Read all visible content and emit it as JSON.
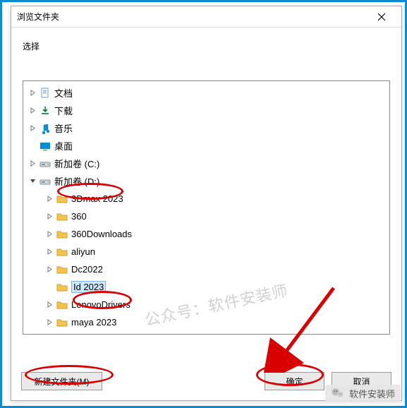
{
  "dialog": {
    "title": "浏览文件夹",
    "subtitle": "选择",
    "close_tooltip": "关闭"
  },
  "tree": {
    "items": [
      {
        "label": "文档",
        "icon": "document",
        "expandable": true,
        "depth": 1
      },
      {
        "label": "下载",
        "icon": "download",
        "expandable": true,
        "depth": 1
      },
      {
        "label": "音乐",
        "icon": "music",
        "expandable": true,
        "depth": 1
      },
      {
        "label": "桌面",
        "icon": "desktop",
        "expandable": false,
        "depth": 1
      },
      {
        "label": "新加卷 (C:)",
        "icon": "drive",
        "expandable": true,
        "depth": 1
      },
      {
        "label": "新加卷 (D:)",
        "icon": "drive",
        "expandable": true,
        "expanded": true,
        "depth": 1,
        "highlighted": true
      },
      {
        "label": "3Dmax 2023",
        "icon": "folder",
        "expandable": true,
        "depth": 2
      },
      {
        "label": "360",
        "icon": "folder",
        "expandable": true,
        "depth": 2
      },
      {
        "label": "360Downloads",
        "icon": "folder",
        "expandable": true,
        "depth": 2
      },
      {
        "label": "aliyun",
        "icon": "folder",
        "expandable": true,
        "depth": 2
      },
      {
        "label": "Dc2022",
        "icon": "folder",
        "expandable": true,
        "depth": 2
      },
      {
        "label": "Id 2023",
        "icon": "folder",
        "expandable": false,
        "depth": 2,
        "selected": true,
        "highlighted": true
      },
      {
        "label": "LenovoDrivers",
        "icon": "folder",
        "expandable": true,
        "depth": 2
      },
      {
        "label": "maya 2023",
        "icon": "folder",
        "expandable": true,
        "depth": 2
      }
    ]
  },
  "buttons": {
    "new_folder": "新建文件夹(M)",
    "ok": "确定",
    "cancel": "取消"
  },
  "watermark": "公众号：软件安装师",
  "footer": "软件安装师"
}
